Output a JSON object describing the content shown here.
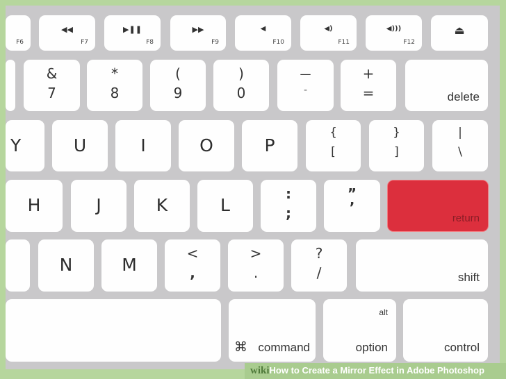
{
  "image": {
    "caption_brand": "wiki",
    "caption_title": "How to Create a Mirror Effect in Adobe Photoshop"
  },
  "colors": {
    "frame": "#b6d69d",
    "keyboard_body": "#c9c8ca",
    "key": "#fefefe",
    "return_key": "#dc2f3d"
  },
  "keyboard": {
    "row1": [
      {
        "fn": "F6",
        "icon": ""
      },
      {
        "fn": "F7",
        "icon": "◀◀",
        "icon_name": "rewind-icon"
      },
      {
        "fn": "F8",
        "icon": "▶❚❚",
        "icon_name": "play-pause-icon"
      },
      {
        "fn": "F9",
        "icon": "▶▶",
        "icon_name": "fast-forward-icon"
      },
      {
        "fn": "F10",
        "icon": "◀",
        "icon_name": "mute-icon"
      },
      {
        "fn": "F11",
        "icon": "◀)",
        "icon_name": "volume-down-icon"
      },
      {
        "fn": "F12",
        "icon": "◀)))",
        "icon_name": "volume-up-icon"
      },
      {
        "fn": "",
        "icon": "⏏",
        "icon_name": "eject-icon"
      }
    ],
    "row2": [
      {
        "top": "",
        "bottom": ""
      },
      {
        "top": "&",
        "bottom": "7"
      },
      {
        "top": "*",
        "bottom": "8"
      },
      {
        "top": "(",
        "bottom": "9"
      },
      {
        "top": ")",
        "bottom": "0"
      },
      {
        "top": "—",
        "bottom": "-"
      },
      {
        "top": "+",
        "bottom": "="
      },
      {
        "word": "delete"
      }
    ],
    "row3": [
      {
        "letter": "Y"
      },
      {
        "letter": "U"
      },
      {
        "letter": "I"
      },
      {
        "letter": "O"
      },
      {
        "letter": "P"
      },
      {
        "top": "{",
        "bottom": "["
      },
      {
        "top": "}",
        "bottom": "]"
      },
      {
        "top": "|",
        "bottom": "\\"
      }
    ],
    "row4": [
      {
        "letter": "H"
      },
      {
        "letter": "J"
      },
      {
        "letter": "K"
      },
      {
        "letter": "L"
      },
      {
        "top": ":",
        "bottom": ";"
      },
      {
        "top": "”",
        "bottom": "’"
      },
      {
        "word": "return"
      }
    ],
    "row5": [
      {
        "letter": ""
      },
      {
        "letter": "N"
      },
      {
        "letter": "M"
      },
      {
        "top": "<",
        "bottom": ","
      },
      {
        "top": ">",
        "bottom": "."
      },
      {
        "top": "?",
        "bottom": "/"
      },
      {
        "word": "shift"
      }
    ],
    "row6": [
      {
        "word": ""
      },
      {
        "symbol": "⌘",
        "word": "command"
      },
      {
        "alt": "alt",
        "word": "option"
      },
      {
        "word": "control"
      }
    ]
  }
}
